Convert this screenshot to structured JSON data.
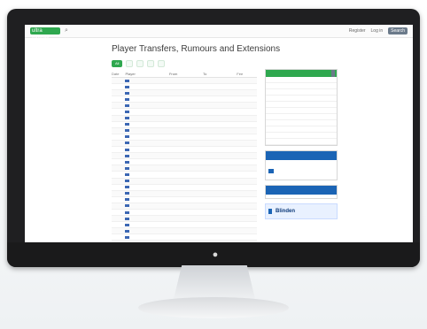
{
  "page": {
    "title": "Player Transfers, Rumours and Extensions",
    "brand": "ultra football",
    "top_nav": [
      "Register",
      "Log in",
      "Search"
    ]
  },
  "tabs": [
    {
      "label": "All",
      "active": true
    },
    {
      "label": "",
      "active": false
    },
    {
      "label": "",
      "active": false
    },
    {
      "label": "",
      "active": false
    },
    {
      "label": "",
      "active": false
    }
  ],
  "table": {
    "columns": [
      "Date",
      "Player",
      "From",
      "To",
      "Fee"
    ],
    "rows": [
      {
        "date": "",
        "player": "",
        "from": "",
        "to": "",
        "fee": ""
      },
      {
        "date": "",
        "player": "",
        "from": "",
        "to": "",
        "fee": ""
      },
      {
        "date": "",
        "player": "",
        "from": "",
        "to": "",
        "fee": ""
      },
      {
        "date": "",
        "player": "",
        "from": "",
        "to": "",
        "fee": ""
      },
      {
        "date": "",
        "player": "",
        "from": "",
        "to": "",
        "fee": ""
      },
      {
        "date": "",
        "player": "",
        "from": "",
        "to": "",
        "fee": ""
      },
      {
        "date": "",
        "player": "",
        "from": "",
        "to": "",
        "fee": ""
      },
      {
        "date": "",
        "player": "",
        "from": "",
        "to": "",
        "fee": ""
      },
      {
        "date": "",
        "player": "",
        "from": "",
        "to": "",
        "fee": ""
      },
      {
        "date": "",
        "player": "",
        "from": "",
        "to": "",
        "fee": ""
      },
      {
        "date": "",
        "player": "",
        "from": "",
        "to": "",
        "fee": ""
      },
      {
        "date": "",
        "player": "",
        "from": "",
        "to": "",
        "fee": ""
      },
      {
        "date": "",
        "player": "",
        "from": "",
        "to": "",
        "fee": ""
      },
      {
        "date": "",
        "player": "",
        "from": "",
        "to": "",
        "fee": ""
      },
      {
        "date": "",
        "player": "",
        "from": "",
        "to": "",
        "fee": ""
      },
      {
        "date": "",
        "player": "",
        "from": "",
        "to": "",
        "fee": ""
      },
      {
        "date": "",
        "player": "",
        "from": "",
        "to": "",
        "fee": ""
      },
      {
        "date": "",
        "player": "",
        "from": "",
        "to": "",
        "fee": ""
      },
      {
        "date": "",
        "player": "",
        "from": "",
        "to": "",
        "fee": ""
      },
      {
        "date": "",
        "player": "",
        "from": "",
        "to": "",
        "fee": ""
      },
      {
        "date": "",
        "player": "",
        "from": "",
        "to": "",
        "fee": ""
      },
      {
        "date": "",
        "player": "",
        "from": "",
        "to": "",
        "fee": ""
      },
      {
        "date": "",
        "player": "",
        "from": "",
        "to": "",
        "fee": ""
      },
      {
        "date": "",
        "player": "",
        "from": "",
        "to": "",
        "fee": ""
      },
      {
        "date": "",
        "player": "",
        "from": "",
        "to": "",
        "fee": ""
      },
      {
        "date": "",
        "player": "",
        "from": "",
        "to": "",
        "fee": ""
      },
      {
        "date": "",
        "player": "",
        "from": "",
        "to": "",
        "fee": ""
      },
      {
        "date": "",
        "player": "",
        "from": "",
        "to": "",
        "fee": ""
      },
      {
        "date": "",
        "player": "",
        "from": "",
        "to": "",
        "fee": ""
      },
      {
        "date": "",
        "player": "",
        "from": "",
        "to": "",
        "fee": ""
      }
    ]
  },
  "sidebar": {
    "panel1": {
      "title": "",
      "tag": "",
      "columns": [
        "",
        "",
        ""
      ],
      "rows": [
        {
          "a": "",
          "b": "",
          "c": ""
        },
        {
          "a": "",
          "b": "",
          "c": ""
        },
        {
          "a": "",
          "b": "",
          "c": ""
        },
        {
          "a": "",
          "b": "",
          "c": ""
        },
        {
          "a": "",
          "b": "",
          "c": ""
        },
        {
          "a": "",
          "b": "",
          "c": ""
        },
        {
          "a": "",
          "b": "",
          "c": ""
        },
        {
          "a": "",
          "b": "",
          "c": ""
        },
        {
          "a": "",
          "b": "",
          "c": ""
        },
        {
          "a": "",
          "b": "",
          "c": ""
        }
      ]
    },
    "ad1": {
      "header": "",
      "text": "",
      "button": ""
    },
    "ad2": {
      "header": "",
      "text": ""
    },
    "banner": {
      "badge": "",
      "text": "Blinden",
      "signature": ""
    }
  },
  "colors": {
    "brand_green": "#2fa84f",
    "link_blue": "#2e6db4",
    "ad_blue": "#1b64b5"
  }
}
